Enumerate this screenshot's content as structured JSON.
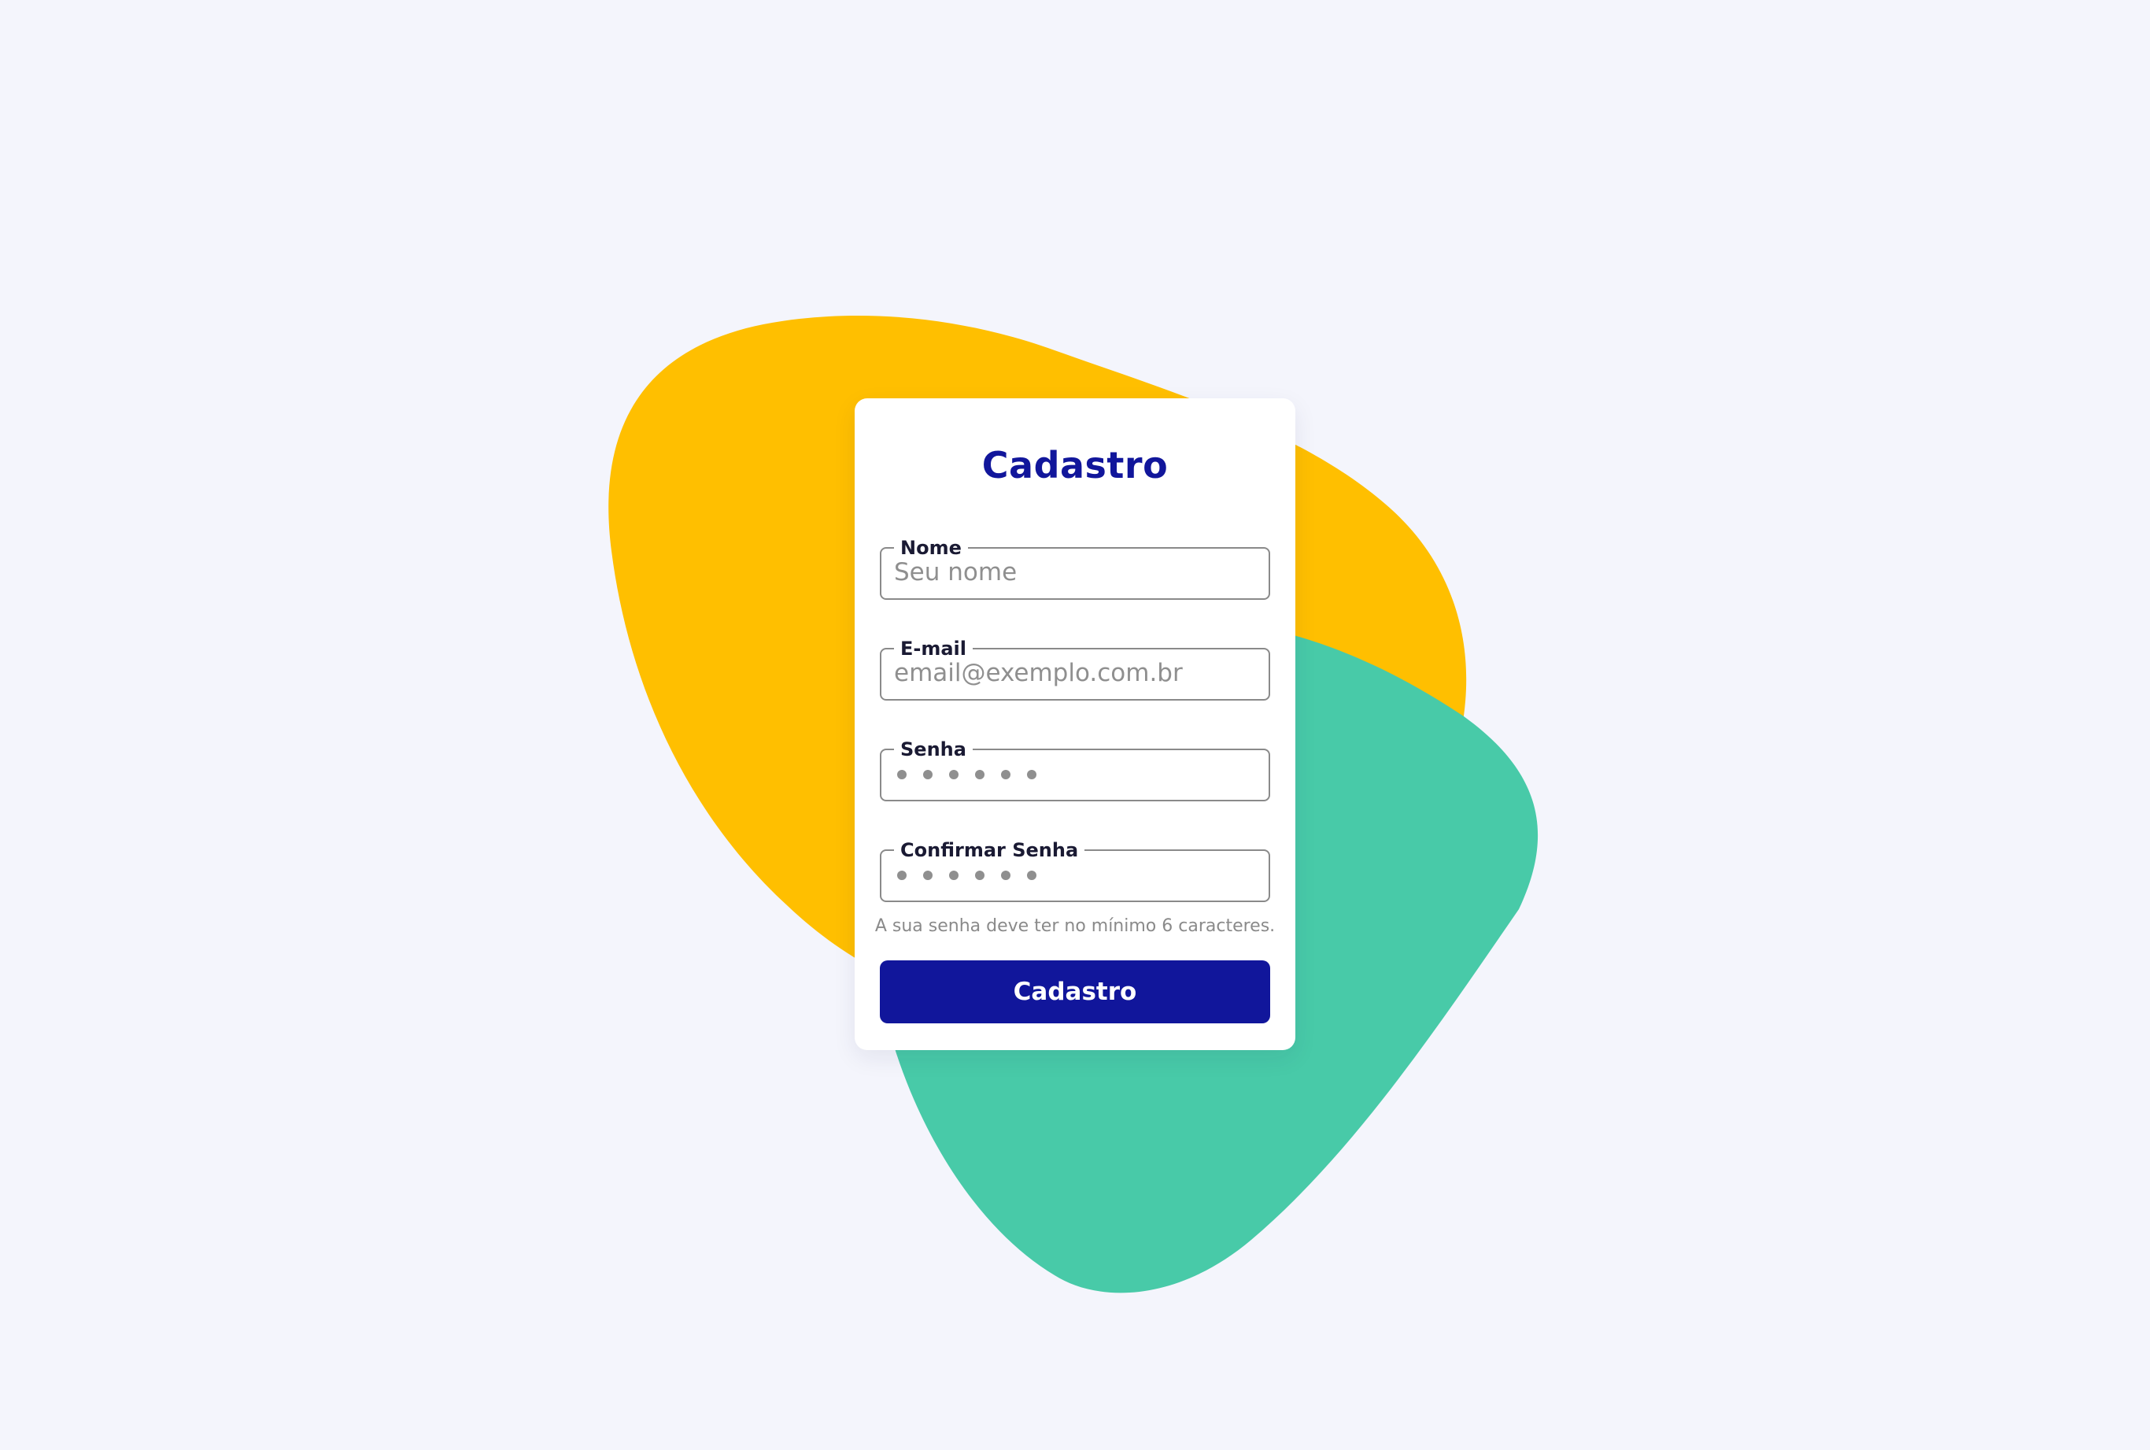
{
  "colors": {
    "background": "#f4f5fc",
    "yellow_blob": "#ffbf00",
    "green_blob": "#48caa8",
    "primary": "#11169b"
  },
  "form": {
    "title": "Cadastro",
    "fields": [
      {
        "label": "Nome",
        "placeholder": "Seu nome",
        "type": "text"
      },
      {
        "label": "E-mail",
        "placeholder": "email@exemplo.com.br",
        "type": "email"
      },
      {
        "label": "Senha",
        "placeholder": "",
        "type": "password",
        "masked_length": 6
      },
      {
        "label": "Confirmar Senha",
        "placeholder": "",
        "type": "password",
        "masked_length": 6
      }
    ],
    "hint": "A sua senha deve ter no mínimo 6 caracteres.",
    "submit_label": "Cadastro"
  }
}
